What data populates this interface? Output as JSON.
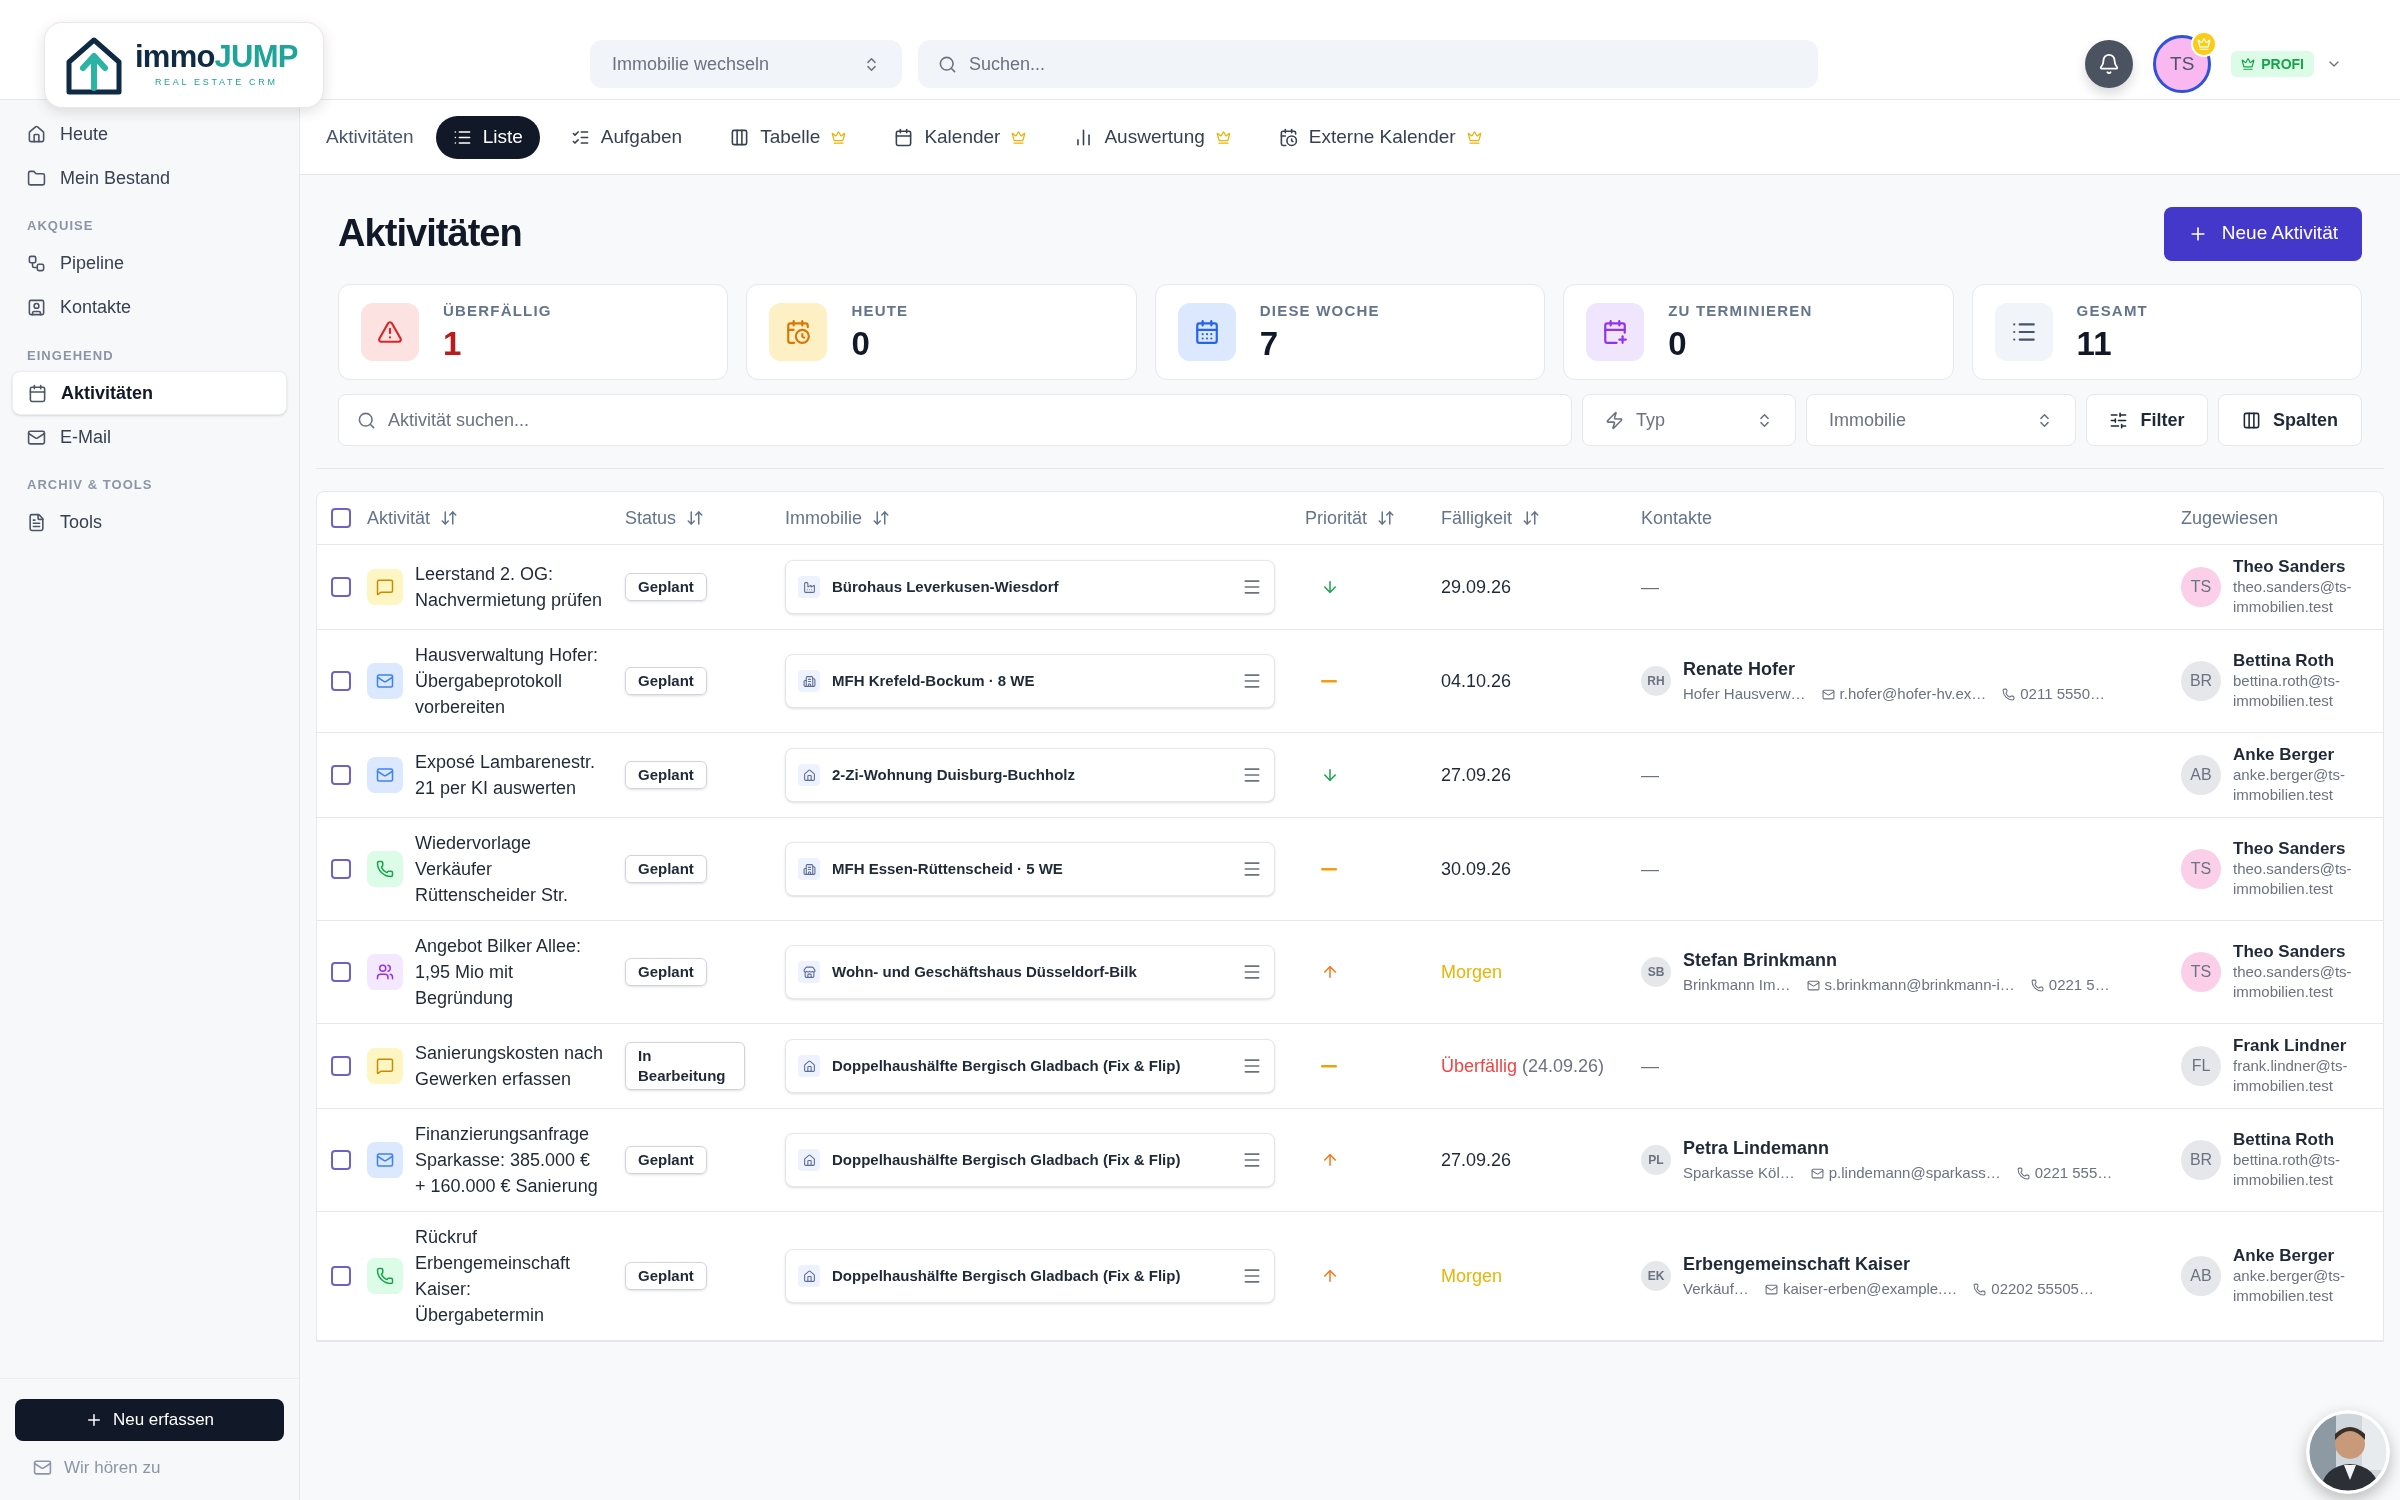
{
  "logo": {
    "part1": "immo",
    "part2": "JUMP",
    "tagline": "REAL ESTATE CRM"
  },
  "topbar": {
    "property_select": {
      "placeholder": "Immobilie wechseln"
    },
    "search": {
      "placeholder": "Suchen..."
    },
    "user": {
      "initials": "TS",
      "premium": true
    },
    "plan_badge": "PROFI"
  },
  "sidebar": {
    "sections": [
      {
        "items": [
          {
            "label": "Heute",
            "selected": false
          },
          {
            "label": "Mein Bestand",
            "selected": false
          }
        ]
      },
      {
        "title": "AKQUISE",
        "items": [
          {
            "label": "Pipeline",
            "selected": false
          },
          {
            "label": "Kontakte",
            "selected": false
          }
        ]
      },
      {
        "title": "EINGEHEND",
        "items": [
          {
            "label": "Aktivitäten",
            "selected": true
          },
          {
            "label": "E-Mail",
            "selected": false
          }
        ]
      },
      {
        "title": "ARCHIV & TOOLS",
        "items": [
          {
            "label": "Tools",
            "selected": false
          }
        ]
      }
    ],
    "new_button": "Neu erfassen",
    "feedback_link": "Wir hören zu"
  },
  "view_tabs": {
    "label": "Aktivitäten",
    "tabs": [
      {
        "label": "Liste",
        "selected": true,
        "premium": false
      },
      {
        "label": "Aufgaben",
        "selected": false,
        "premium": false
      },
      {
        "label": "Tabelle",
        "selected": false,
        "premium": true
      },
      {
        "label": "Kalender",
        "selected": false,
        "premium": true
      },
      {
        "label": "Auswertung",
        "selected": false,
        "premium": true
      },
      {
        "label": "Externe Kalender",
        "selected": false,
        "premium": true
      }
    ]
  },
  "page_title": "Aktivitäten",
  "new_activity_button": "Neue Aktivität",
  "stats": [
    {
      "kind": "overdue",
      "label": "ÜBERFÄLLIG",
      "value": "1"
    },
    {
      "kind": "today",
      "label": "HEUTE",
      "value": "0"
    },
    {
      "kind": "week",
      "label": "DIESE WOCHE",
      "value": "7"
    },
    {
      "kind": "schedule",
      "label": "ZU TERMINIEREN",
      "value": "0"
    },
    {
      "kind": "total",
      "label": "GESAMT",
      "value": "11"
    }
  ],
  "filters": {
    "search": {
      "placeholder": "Aktivität suchen..."
    },
    "type_select": "Typ",
    "property_select": "Immobilie",
    "filter_button": "Filter",
    "columns_button": "Spalten"
  },
  "table": {
    "select_all_checked": false,
    "columns": [
      {
        "label": "Aktivität",
        "sortable": true
      },
      {
        "label": "Status",
        "sortable": true
      },
      {
        "label": "Immobilie",
        "sortable": true
      },
      {
        "label": "Priorität",
        "sortable": true
      },
      {
        "label": "Fälligkeit",
        "sortable": true
      },
      {
        "label": "Kontakte",
        "sortable": false
      },
      {
        "label": "Zugewiesen",
        "sortable": false
      }
    ],
    "rows": [
      {
        "checked": false,
        "kind": "note",
        "title": "Leerstand 2. OG: Nachvermietung prüfen",
        "status": "Geplant",
        "property": {
          "kind": "office",
          "name": "Bürohaus Leverkusen-Wiesdorf"
        },
        "priority": {
          "kind": "low"
        },
        "due": {
          "kind": "normal",
          "text": "29.09.26"
        },
        "contact_empty": "—",
        "assignee": {
          "initials": "TS",
          "name": "Theo Sanders",
          "email": "theo.sanders@ts-immobilien.test",
          "color": "#fbcfe8"
        }
      },
      {
        "checked": false,
        "kind": "mail",
        "title": "Hausverwaltung Hofer: Übergabeprotokoll vorbereiten",
        "status": "Geplant",
        "property": {
          "kind": "building",
          "name": "MFH Krefeld-Bockum · 8 WE"
        },
        "priority": {
          "kind": "medium"
        },
        "due": {
          "kind": "normal",
          "text": "04.10.26"
        },
        "contact": {
          "initials": "RH",
          "name": "Renate Hofer",
          "company": "Hofer Hausverw…",
          "email": "r.hofer@hofer-hv.ex…",
          "phone": "0211 5550…"
        },
        "assignee": {
          "initials": "BR",
          "name": "Bettina Roth",
          "email": "bettina.roth@ts-immobilien.test",
          "color": "#e5e7eb"
        }
      },
      {
        "checked": false,
        "kind": "mail",
        "title": "Exposé Lambarenestr. 21 per KI auswerten",
        "status": "Geplant",
        "property": {
          "kind": "home",
          "name": "2-Zi-Wohnung Duisburg-Buchholz"
        },
        "priority": {
          "kind": "low"
        },
        "due": {
          "kind": "normal",
          "text": "27.09.26"
        },
        "contact_empty": "—",
        "assignee": {
          "initials": "AB",
          "name": "Anke Berger",
          "email": "anke.berger@ts-immobilien.test",
          "color": "#e5e7eb"
        }
      },
      {
        "checked": false,
        "kind": "phone",
        "title": "Wiedervorlage Verkäufer Rüttenscheider Str.",
        "status": "Geplant",
        "property": {
          "kind": "building",
          "name": "MFH Essen-Rüttenscheid · 5 WE"
        },
        "priority": {
          "kind": "medium"
        },
        "due": {
          "kind": "normal",
          "text": "30.09.26"
        },
        "contact_empty": "—",
        "assignee": {
          "initials": "TS",
          "name": "Theo Sanders",
          "email": "theo.sanders@ts-immobilien.test",
          "color": "#fbcfe8"
        }
      },
      {
        "checked": false,
        "kind": "meeting",
        "title": "Angebot Bilker Allee: 1,95 Mio mit Begründung",
        "status": "Geplant",
        "property": {
          "kind": "store",
          "name": "Wohn- und Geschäftshaus Düsseldorf-Bilk"
        },
        "priority": {
          "kind": "high"
        },
        "due": {
          "kind": "tomorrow",
          "text": "Morgen"
        },
        "contact": {
          "initials": "SB",
          "name": "Stefan Brinkmann",
          "company": "Brinkmann Im…",
          "email": "s.brinkmann@brinkmann-i…",
          "phone": "0221 5…"
        },
        "assignee": {
          "initials": "TS",
          "name": "Theo Sanders",
          "email": "theo.sanders@ts-immobilien.test",
          "color": "#fbcfe8"
        }
      },
      {
        "checked": false,
        "kind": "note",
        "title": "Sanierungskosten nach Gewerken erfassen",
        "status": "In Bearbeitung",
        "property": {
          "kind": "home",
          "name": "Doppelhaushälfte Bergisch Gladbach (Fix & Flip)"
        },
        "priority": {
          "kind": "medium"
        },
        "due": {
          "kind": "overdue",
          "text": "Überfällig",
          "detail": "(24.09.26)"
        },
        "contact_empty": "—",
        "assignee": {
          "initials": "FL",
          "name": "Frank Lindner",
          "email": "frank.lindner@ts-immobilien.test",
          "color": "#e5e7eb"
        }
      },
      {
        "checked": false,
        "kind": "mail",
        "title": "Finanzierungsanfrage Sparkasse: 385.000 € + 160.000 € Sanierung",
        "status": "Geplant",
        "property": {
          "kind": "home",
          "name": "Doppelhaushälfte Bergisch Gladbach (Fix & Flip)"
        },
        "priority": {
          "kind": "high"
        },
        "due": {
          "kind": "normal",
          "text": "27.09.26"
        },
        "contact": {
          "initials": "PL",
          "name": "Petra Lindemann",
          "company": "Sparkasse Köl…",
          "email": "p.lindemann@sparkass…",
          "phone": "0221 555…"
        },
        "assignee": {
          "initials": "BR",
          "name": "Bettina Roth",
          "email": "bettina.roth@ts-immobilien.test",
          "color": "#e5e7eb"
        }
      },
      {
        "checked": false,
        "kind": "phone",
        "title": "Rückruf Erbengemeinschaft Kaiser: Übergabetermin",
        "status": "Geplant",
        "property": {
          "kind": "home",
          "name": "Doppelhaushälfte Bergisch Gladbach (Fix & Flip)"
        },
        "priority": {
          "kind": "high"
        },
        "due": {
          "kind": "tomorrow",
          "text": "Morgen"
        },
        "contact": {
          "initials": "EK",
          "name": "Erbengemeinschaft Kaiser",
          "company": "Verkäuf…",
          "email": "kaiser-erben@example.…",
          "phone": "02202 55505…"
        },
        "assignee": {
          "initials": "AB",
          "name": "Anke Berger",
          "email": "anke.berger@ts-immobilien.test",
          "color": "#e5e7eb"
        }
      }
    ]
  }
}
